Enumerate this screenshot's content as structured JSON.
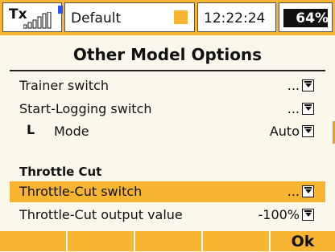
{
  "status": {
    "tx_label": "Tx",
    "profile": "Default",
    "time": "12:22:24",
    "battery_percent": "64%",
    "battery_level": 0.64,
    "accent": "#f7b531",
    "bt_color": "#2a53ff"
  },
  "page": {
    "title": "Other Model Options"
  },
  "rows": [
    {
      "label": "Trainer switch",
      "value": "..."
    },
    {
      "label": "Start-Logging switch",
      "value": "..."
    },
    {
      "label": "Mode",
      "value": "Auto",
      "indent_glyph": "L"
    }
  ],
  "section": {
    "title": "Throttle Cut"
  },
  "rows2": [
    {
      "label": "Throttle-Cut switch",
      "value": "...",
      "selected": true
    },
    {
      "label": "Throttle-Cut output value",
      "value": "-100%"
    }
  ],
  "softkeys": {
    "f1": "",
    "f2": "",
    "f3": "",
    "f4": "",
    "f5": "Ok"
  }
}
